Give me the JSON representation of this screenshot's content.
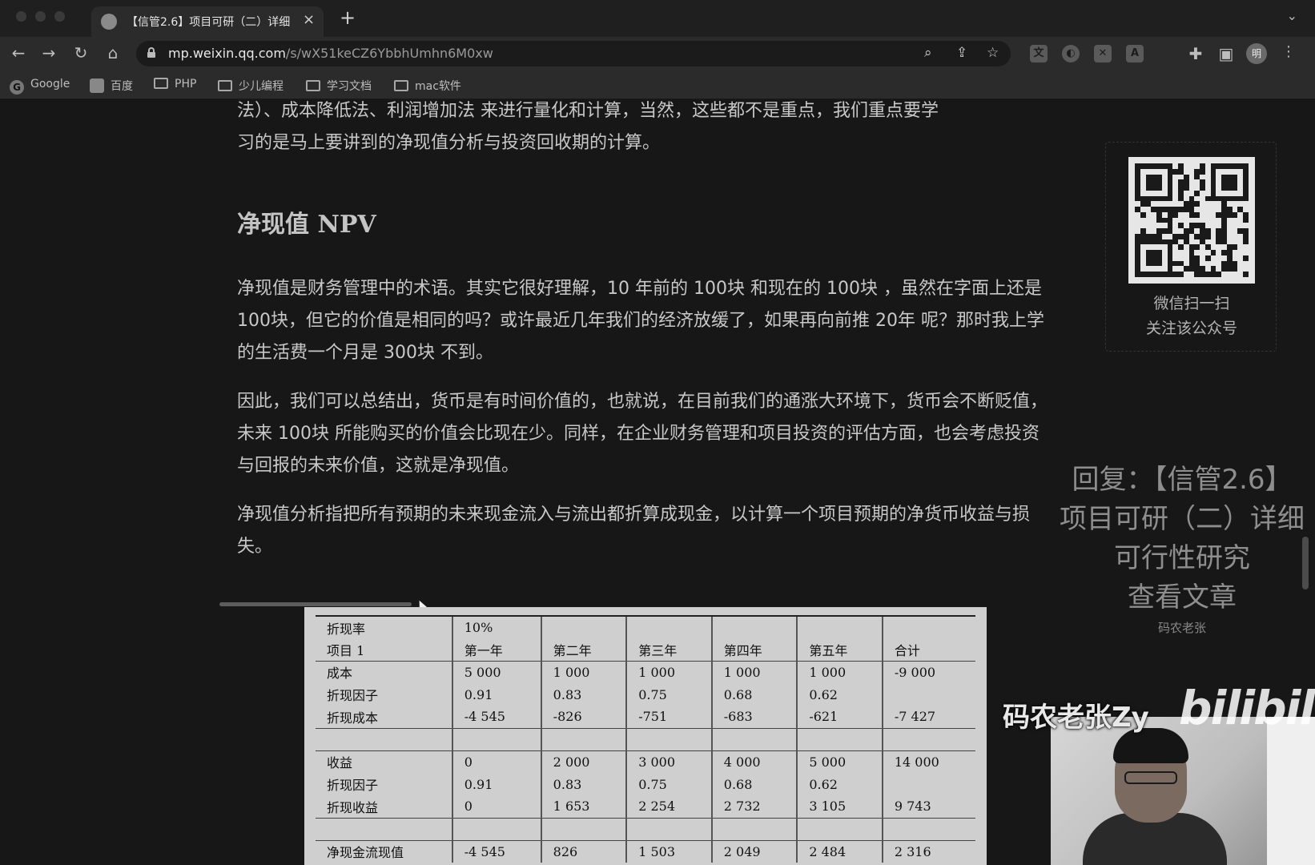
{
  "browser": {
    "tab_title": "【信管2.6】项目可研（二）详细",
    "tab_close": "×",
    "new_tab": "+",
    "url_host": "mp.weixin.qq.com",
    "url_path": "/s/wX51keCZ6YbbhUmhn6M0xw",
    "profile_initial": "明",
    "bookmarks": [
      "Google",
      "百度",
      "PHP",
      "少儿编程",
      "学习文档",
      "mac软件"
    ]
  },
  "article": {
    "intro_line_1": "法）、成本降低法、利润增加法 来进行量化和计算，当然，这些都不是重点，我们重点要学",
    "intro_line_2": "习的是马上要讲到的净现值分析与投资回收期的计算。",
    "heading": "净现值 NPV",
    "para1": "净现值是财务管理中的术语。其实它很好理解，10 年前的 100块 和现在的 100块 ，虽然在字面上还是 100块，但它的价值是相同的吗？或许最近几年我们的经济放缓了，如果再向前推 20年 呢？那时我上学的生活费一个月是 300块 不到。",
    "para2": "因此，我们可以总结出，货币是有时间价值的，也就说，在目前我们的通涨大环境下，货币会不断贬值，未来 100块 所能购买的价值会比现在少。同样，在企业财务管理和项目投资的评估方面，也会考虑投资与回报的未来价值，这就是净现值。",
    "para3": "净现值分析指把所有预期的未来现金流入与流出都折算成现金，以计算一个项目预期的净货币收益与损失。"
  },
  "table": {
    "rate_label": "折现率",
    "rate_value": "10%",
    "header": [
      "项目 1",
      "第一年",
      "第二年",
      "第三年",
      "第四年",
      "第五年",
      "合计"
    ],
    "rows_cost": [
      [
        "成本",
        "5 000",
        "1 000",
        "1 000",
        "1 000",
        "1 000",
        "-9 000"
      ],
      [
        "折现因子",
        "0.91",
        "0.83",
        "0.75",
        "0.68",
        "0.62",
        ""
      ],
      [
        "折现成本",
        "-4 545",
        "-826",
        "-751",
        "-683",
        "-621",
        "-7 427"
      ]
    ],
    "rows_income": [
      [
        "收益",
        "0",
        "2 000",
        "3 000",
        "4 000",
        "5 000",
        "14 000"
      ],
      [
        "折现因子",
        "0.91",
        "0.83",
        "0.75",
        "0.68",
        "0.62",
        ""
      ],
      [
        "折现收益",
        "0",
        "1 653",
        "2 254",
        "2 732",
        "3 105",
        "9 743"
      ]
    ],
    "row_net": [
      "净现金流现值",
      "-4 545",
      "826",
      "1 503",
      "2 049",
      "2 484",
      "2 316"
    ]
  },
  "sidebar": {
    "qr_line_1": "微信扫一扫",
    "qr_line_2": "关注该公众号"
  },
  "overlay": {
    "line1": "回复：【信管2.6】",
    "line2": "项目可研（二）详细",
    "line3": "可行性研究",
    "line4": "查看文章",
    "author": "码农老张"
  },
  "video": {
    "streamer_label": "码农老张Zy",
    "platform_logo": "bilibili"
  }
}
